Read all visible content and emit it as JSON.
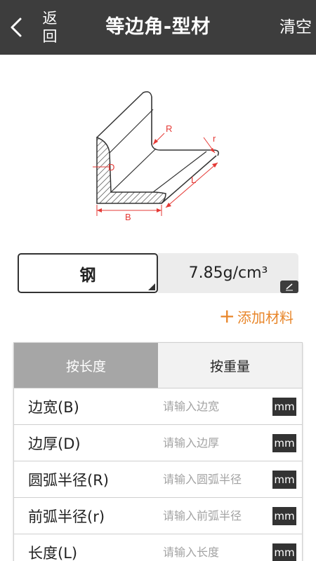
{
  "header": {
    "back_label": "返回",
    "title": "等边角-型材",
    "clear_label": "清空"
  },
  "diagram": {
    "labels": {
      "R": "R",
      "r": "r",
      "D": "D",
      "L": "L",
      "B": "B"
    },
    "label_color": "#e53935"
  },
  "material": {
    "name": "钢",
    "density": "7.85g/cm³"
  },
  "add_material_label": "添加材料",
  "tabs": [
    {
      "label": "按长度",
      "active": true
    },
    {
      "label": "按重量",
      "active": false
    }
  ],
  "fields": [
    {
      "label": "边宽(B)",
      "placeholder": "请输入边宽",
      "unit": "mm"
    },
    {
      "label": "边厚(D)",
      "placeholder": "请输入边厚",
      "unit": "mm"
    },
    {
      "label": "圆弧半径(R)",
      "placeholder": "请输入圆弧半径",
      "unit": "mm"
    },
    {
      "label": "前弧半径(r)",
      "placeholder": "请输入前弧半径",
      "unit": "mm"
    },
    {
      "label": "长度(L)",
      "placeholder": "请输入长度",
      "unit": "mm"
    }
  ],
  "colors": {
    "header_bg": "#3d3d3d",
    "accent": "#e8862a",
    "active_tab": "#a6a6a6"
  }
}
